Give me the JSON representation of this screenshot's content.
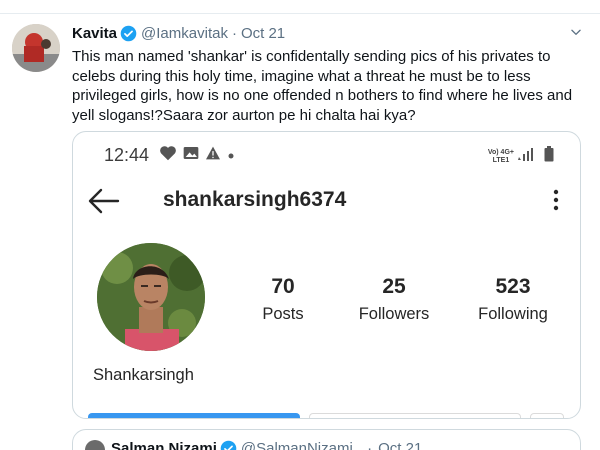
{
  "tweet": {
    "display_name": "Kavita",
    "handle": "@Iamkavitak",
    "separator": "·",
    "date": "Oct 21",
    "text": "This man named 'shankar' is confidentally sending pics of his privates to celebs during this holy time, imagine what a threat he must be to less privileged girls, how is no one offended n bothers to find where he lives and yell slogans!?Saara zor aurton pe hi chalta hai kya?"
  },
  "screenshot": {
    "status_bar": {
      "time": "12:44",
      "network_top": "Vo) 4G+",
      "network_bottom": "LTE1"
    },
    "instagram": {
      "username": "shankarsingh6374",
      "name": "Shankarsingh",
      "stats": [
        {
          "value": "70",
          "label": "Posts"
        },
        {
          "value": "25",
          "label": "Followers"
        },
        {
          "value": "523",
          "label": "Following"
        }
      ]
    }
  },
  "quoted_tweet": {
    "display_name": "Salman Nizami",
    "handle": "@SalmanNizami_",
    "separator": "·",
    "date": "Oct 21"
  },
  "colors": {
    "verified_blue": "#1da1f2",
    "instagram_blue": "#3897f0",
    "secondary_text": "#5b7083"
  }
}
